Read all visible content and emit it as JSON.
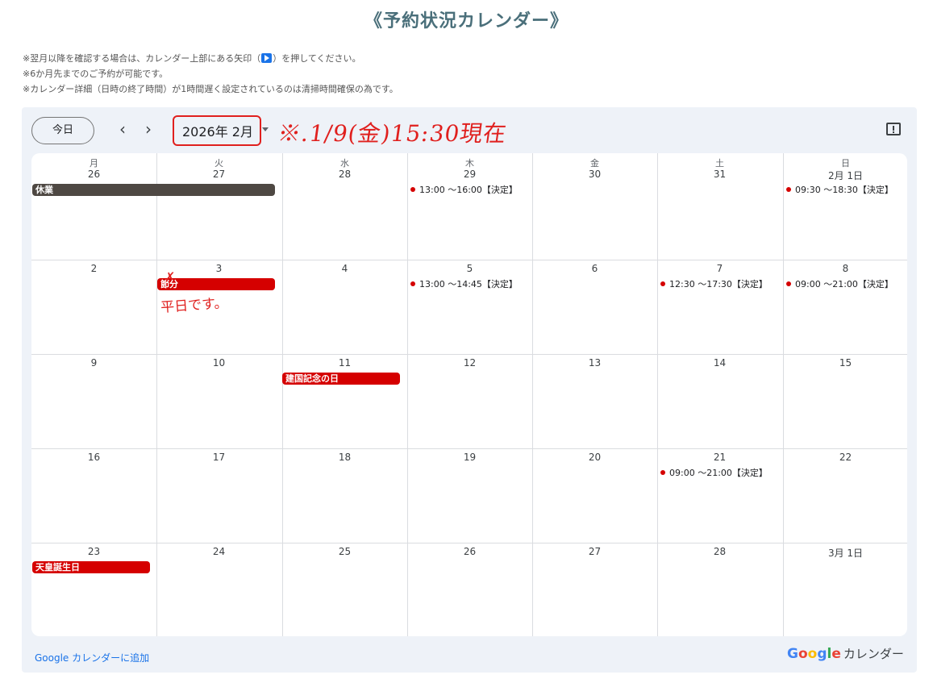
{
  "title": "《予約状況カレンダー》",
  "notes": {
    "line1_before": "※翌月以降を確認する場合は、カレンダー上部にある矢印（",
    "line1_after": "）を押してください。",
    "line2": "※6か月先までのご予約が可能です。",
    "line3": "※カレンダー詳細（日時の終了時間）が1時間遅く設定されているのは清掃時間確保の為です。"
  },
  "toolbar": {
    "today_label": "今日",
    "prev_label": "‹",
    "next_label": "›",
    "month_label": "2026年 2月",
    "handwritten_note": "※.1/9(金)15:30現在"
  },
  "weekdays": [
    "月",
    "火",
    "水",
    "木",
    "金",
    "土",
    "日"
  ],
  "weeks": [
    [
      "26",
      "27",
      "28",
      "29",
      "30",
      "31",
      "2月 1日"
    ],
    [
      "2",
      "3",
      "4",
      "5",
      "6",
      "7",
      "8"
    ],
    [
      "9",
      "10",
      "11",
      "12",
      "13",
      "14",
      "15"
    ],
    [
      "16",
      "17",
      "18",
      "19",
      "20",
      "21",
      "22"
    ],
    [
      "23",
      "24",
      "25",
      "26",
      "27",
      "28",
      "3月 1日"
    ]
  ],
  "allday_events": [
    {
      "label": "休業",
      "color": "#4e4843"
    },
    {
      "label": "節分",
      "color": "#d50000"
    },
    {
      "label": "建国記念の日",
      "color": "#d50000"
    },
    {
      "label": "天皇誕生日",
      "color": "#d50000"
    }
  ],
  "timed_events": [
    {
      "text": "13:00 ～16:00【決定】"
    },
    {
      "text": "09:30 ～18:30【決定】"
    },
    {
      "text": "13:00 ～14:45【決定】"
    },
    {
      "text": "12:30 ～17:30【決定】"
    },
    {
      "text": "09:00 ～21:00【決定】"
    },
    {
      "text": "09:00 ～21:00【決定】"
    }
  ],
  "event_dot_color": "#d50000",
  "annotation_scribble": "平日です。",
  "footer": {
    "add_link": "Google カレンダーに追加",
    "brand_text": "カレンダー",
    "logo_letters": [
      "G",
      "o",
      "o",
      "g",
      "l",
      "e"
    ],
    "logo_colors": [
      "#4285f4",
      "#ea4335",
      "#fbbc05",
      "#4285f4",
      "#34a853",
      "#ea4335"
    ]
  },
  "colors": {
    "accent_red": "#e0201e",
    "link_blue": "#1a73e8",
    "frame_bg": "#eef2f8",
    "title_color": "#4a6f7a"
  }
}
